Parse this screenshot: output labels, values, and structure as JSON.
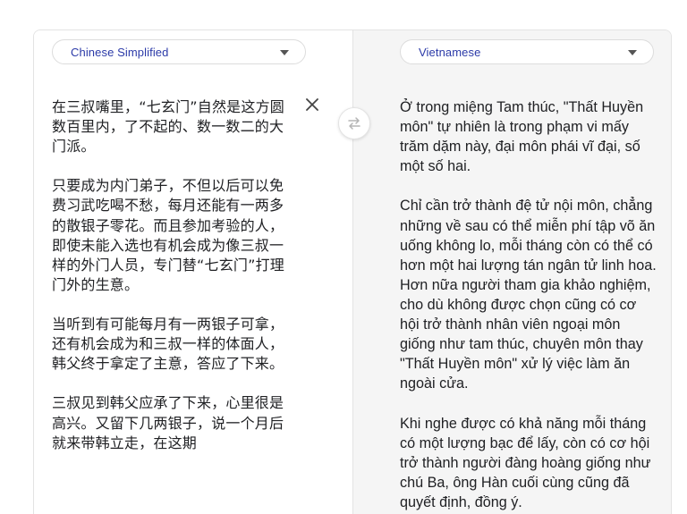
{
  "source": {
    "language": "Chinese Simplified",
    "text": "在三叔嘴里，“七玄门”自然是这方圆数百里内，了不起的、数一数二的大门派。\n\n只要成为内门弟子，不但以后可以免费习武吃喝不愁，每月还能有一两多的散银子零花。而且参加考验的人，即使未能入选也有机会成为像三叔一样的外门人员，专门替“七玄门”打理门外的生意。\n\n当听到有可能每月有一两银子可拿，还有机会成为和三叔一样的体面人，韩父终于拿定了主意，答应了下来。\n\n三叔见到韩父应承了下来，心里很是高兴。又留下几两银子，说一个月后就来带韩立走，在这期"
  },
  "target": {
    "language": "Vietnamese",
    "text": "Ở trong miệng Tam thúc, \"Thất Huyền môn\" tự nhiên là trong phạm vi mấy trăm dặm này, đại môn phái vĩ đại, số một số hai.\n\nChỉ cần trở thành đệ tử nội môn, chẳng những về sau có thể miễn phí tập võ ăn uống không lo, mỗi tháng còn có thể có hơn một hai lượng tán ngân tử linh hoa. Hơn nữa người tham gia khảo nghiệm, cho dù không được chọn cũng có cơ hội trở thành nhân viên ngoại môn giống như tam thúc, chuyên môn thay \"Thất Huyền môn\" xử lý việc làm ăn ngoài cửa.\n\nKhi nghe được có khả năng mỗi tháng có một lượng bạc để lấy, còn có cơ hội trở thành người đàng hoàng giống như chú Ba, ông Hàn cuối cùng cũng đã quyết định, đồng ý."
  },
  "icons": {
    "clear": "close-icon",
    "swap": "swap-arrows-icon",
    "dropdown": "caret-down-icon"
  },
  "colors": {
    "language_label": "#2b3aa8",
    "result_background": "#f5f5f5",
    "border": "#e3e3e3"
  }
}
